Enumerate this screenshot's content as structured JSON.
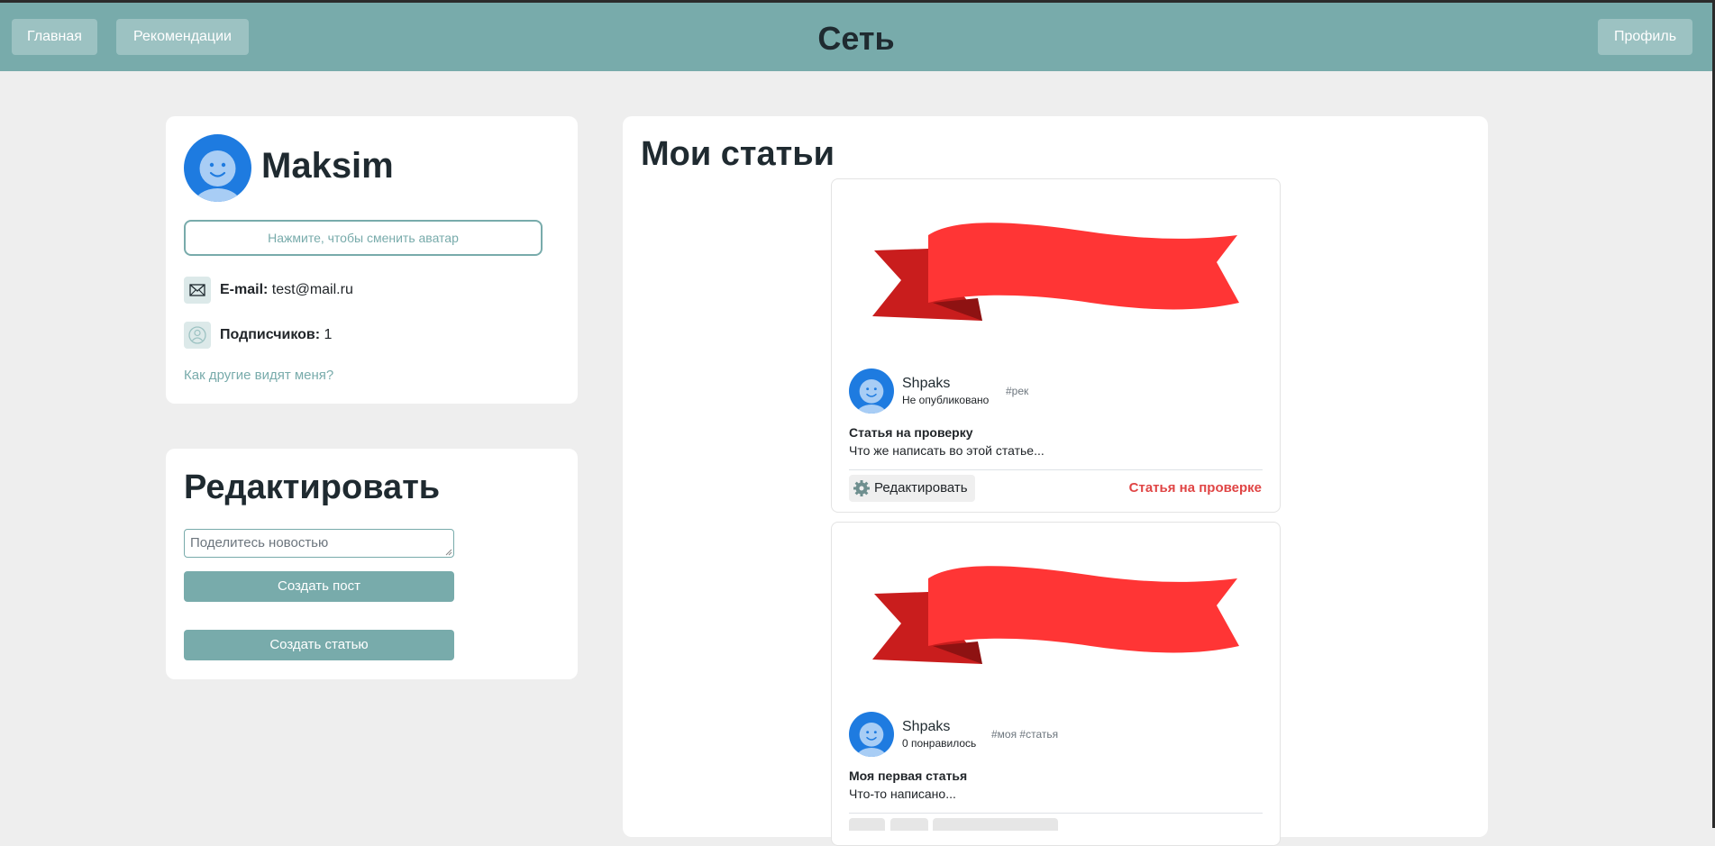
{
  "nav": {
    "home_label": "Главная",
    "recommend_label": "Рекомендации",
    "brand": "Сеть",
    "profile_label": "Профиль"
  },
  "profile": {
    "name": "Maksim",
    "change_avatar_label": "Нажмите, чтобы сменить аватар",
    "email_label": "E-mail:",
    "email_value": "test@mail.ru",
    "subscribers_label": "Подписчиков:",
    "subscribers_value": "1",
    "others_view_link": "Как другие видят меня?"
  },
  "editor": {
    "title": "Редактировать",
    "news_placeholder": "Поделитесь новостью",
    "create_post_label": "Создать пост",
    "create_article_label": "Создать статью"
  },
  "articles": {
    "section_title": "Мои статьи",
    "items": [
      {
        "author": "Shpaks",
        "meta": "Не опубликовано",
        "tags": "#рек",
        "title": "Статья на проверку",
        "text": "Что же написать во этой статье...",
        "edit_label": "Редактировать",
        "status": "Статья на проверке"
      },
      {
        "author": "Shpaks",
        "meta": "0 понравилось",
        "tags": "#моя #статья",
        "title": "Моя первая статья",
        "text": "Что-то написано..."
      }
    ]
  },
  "colors": {
    "accent": "#78abab",
    "avatar": "#1e7be0",
    "ribbon": "#ff3535",
    "status": "#e04545"
  }
}
